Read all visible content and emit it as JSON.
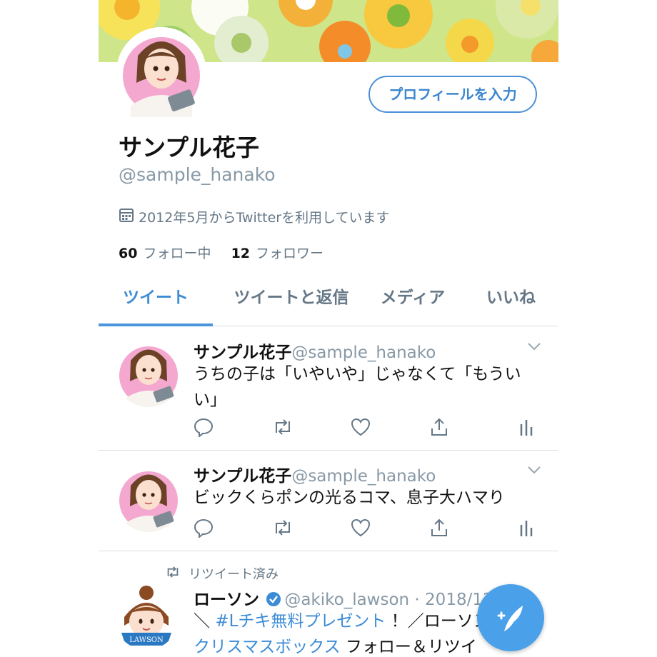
{
  "profile": {
    "edit_button": "プロフィールを入力",
    "display_name": "サンプル花子",
    "handle": "@sample_hanako",
    "joined": "2012年5月からTwitterを利用しています",
    "following_count": "60",
    "following_label": "フォロー中",
    "followers_count": "12",
    "followers_label": "フォロワー"
  },
  "tabs": [
    {
      "label": "ツイート",
      "active": true
    },
    {
      "label": "ツイートと返信",
      "active": false
    },
    {
      "label": "メディア",
      "active": false
    },
    {
      "label": "いいね",
      "active": false
    }
  ],
  "tweets": [
    {
      "name": "サンプル花子",
      "handle": "@sample_hanako",
      "text": "うちの子は「いやいや」じゃなくて「もういい」"
    },
    {
      "name": "サンプル花子",
      "handle": "@sample_hanako",
      "text": "ビックくらポンの光るコマ、息子大ハマり"
    },
    {
      "retweet_label": "リツイート済み",
      "name": "ローソン",
      "handle": "@akiko_lawson · 2018/12",
      "text_prefix": "＼ ",
      "hashtag": "#Lチキ無料プレゼント",
      "text_mid": " ！／ローソン",
      "link2": "クリスマスボックス",
      "text_suffix": " フォロー＆リツイ",
      "avatar_label": "LAWSON"
    }
  ],
  "icons": {
    "calendar": "calendar-icon",
    "reply": "reply-icon",
    "retweet": "retweet-icon",
    "like": "heart-icon",
    "share": "share-icon",
    "analytics": "analytics-icon",
    "verified": "verified-badge-icon",
    "compose": "compose-tweet-icon"
  },
  "colors": {
    "accent": "#3b8bd6",
    "muted": "#657786",
    "fab": "#4aa1ea"
  }
}
